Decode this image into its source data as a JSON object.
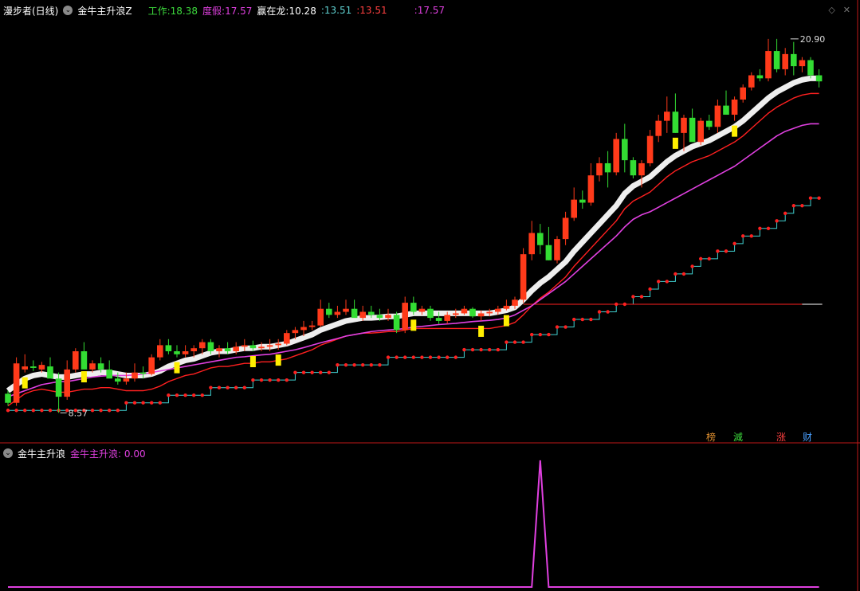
{
  "main_panel": {
    "stock_name": "漫步者(日线)",
    "indicator_name": "金牛主升浪Z",
    "legend": [
      {
        "label": "工作:",
        "value": "18.38",
        "color": "#3ddc3d"
      },
      {
        "label": "度假:",
        "value": "17.57",
        "color": "#e040e0"
      },
      {
        "label": "赢在龙:",
        "value": "10.28",
        "color": "#ffffff"
      },
      {
        "label": ":",
        "value": "13.51",
        "color": "#5fd0d0"
      },
      {
        "label": ":",
        "value": "13.51",
        "color": "#ff4040"
      },
      {
        "label": ":",
        "value": "17.57",
        "color": "#e040e0"
      }
    ],
    "high_marker": "20.90",
    "low_marker": "8.57",
    "icons": [
      "diamond-icon",
      "close-icon"
    ],
    "badges": [
      {
        "label": "榜",
        "color": "#e09030"
      },
      {
        "label": "減",
        "color": "#3ddc3d"
      },
      {
        "label": "涨",
        "color": "#ff4040"
      },
      {
        "label": "财",
        "color": "#4aa0ff"
      }
    ]
  },
  "sub_panel": {
    "indicator_name": "金牛主升浪",
    "legend_label": "金牛主升浪:",
    "legend_value": "0.00",
    "legend_color": "#e040e0"
  },
  "colors": {
    "up": "#ff3a1a",
    "down": "#33dd33",
    "support": "#ff3030",
    "mid": "#e040e0",
    "hint": "#ffee00",
    "stair": "#ff2020",
    "stair_line": "#40d0d0"
  },
  "chart_data": [
    {
      "type": "candlestick",
      "title": "漫步者(日线)",
      "y_range": [
        8.0,
        21.5
      ],
      "candles": [
        [
          9.2,
          9.3,
          8.8,
          8.9
        ],
        [
          8.9,
          10.4,
          8.8,
          10.2
        ],
        [
          10.0,
          10.5,
          9.9,
          10.1
        ],
        [
          10.1,
          10.3,
          9.95,
          10.05
        ],
        [
          10.0,
          10.25,
          9.9,
          10.15
        ],
        [
          10.1,
          10.4,
          9.9,
          9.7
        ],
        [
          9.7,
          9.9,
          8.57,
          9.1
        ],
        [
          9.1,
          10.3,
          9.0,
          10.0
        ],
        [
          10.0,
          10.7,
          9.9,
          10.6
        ],
        [
          10.6,
          10.9,
          10.1,
          10.0
        ],
        [
          10.0,
          10.3,
          9.9,
          10.2
        ],
        [
          10.2,
          10.4,
          9.9,
          10.0
        ],
        [
          10.0,
          10.3,
          9.8,
          9.7
        ],
        [
          9.7,
          9.9,
          9.5,
          9.6
        ],
        [
          9.6,
          9.9,
          9.5,
          9.7
        ],
        [
          9.7,
          10.2,
          9.6,
          9.9
        ],
        [
          9.9,
          10.1,
          9.7,
          9.85
        ],
        [
          9.85,
          10.5,
          9.8,
          10.4
        ],
        [
          10.4,
          11.0,
          10.3,
          10.8
        ],
        [
          10.8,
          11.0,
          10.5,
          10.6
        ],
        [
          10.6,
          10.8,
          10.4,
          10.5
        ],
        [
          10.5,
          10.8,
          10.4,
          10.6
        ],
        [
          10.6,
          10.8,
          10.4,
          10.7
        ],
        [
          10.7,
          11.0,
          10.5,
          10.9
        ],
        [
          10.9,
          11.0,
          10.5,
          10.6
        ],
        [
          10.6,
          10.8,
          10.4,
          10.7
        ],
        [
          10.7,
          10.9,
          10.5,
          10.6
        ],
        [
          10.6,
          10.9,
          10.5,
          10.75
        ],
        [
          10.75,
          11.0,
          10.6,
          10.8
        ],
        [
          10.8,
          10.95,
          10.6,
          10.7
        ],
        [
          10.7,
          10.9,
          10.6,
          10.75
        ],
        [
          10.75,
          11.0,
          10.6,
          10.8
        ],
        [
          10.8,
          11.0,
          10.65,
          10.85
        ],
        [
          10.85,
          11.3,
          10.8,
          11.2
        ],
        [
          11.2,
          11.4,
          11.0,
          11.3
        ],
        [
          11.3,
          11.6,
          11.1,
          11.4
        ],
        [
          11.4,
          11.6,
          11.3,
          11.45
        ],
        [
          11.45,
          12.3,
          11.4,
          12.0
        ],
        [
          12.0,
          12.2,
          11.7,
          11.8
        ],
        [
          11.8,
          12.1,
          11.7,
          11.9
        ],
        [
          11.9,
          12.3,
          11.8,
          12.0
        ],
        [
          12.0,
          12.3,
          11.9,
          11.7
        ],
        [
          11.7,
          12.1,
          11.6,
          11.9
        ],
        [
          11.9,
          12.1,
          11.7,
          11.8
        ],
        [
          11.8,
          12.0,
          11.6,
          11.7
        ],
        [
          11.7,
          12.0,
          11.6,
          11.8
        ],
        [
          11.8,
          11.9,
          11.2,
          11.3
        ],
        [
          11.3,
          12.4,
          11.2,
          12.2
        ],
        [
          12.2,
          12.4,
          11.8,
          11.9
        ],
        [
          11.9,
          12.1,
          11.8,
          12.0
        ],
        [
          12.0,
          12.1,
          11.6,
          11.7
        ],
        [
          11.7,
          11.9,
          11.5,
          11.6
        ],
        [
          11.6,
          11.9,
          11.5,
          11.8
        ],
        [
          11.8,
          12.0,
          11.7,
          11.85
        ],
        [
          11.85,
          12.1,
          11.8,
          12.0
        ],
        [
          12.0,
          12.05,
          11.7,
          11.75
        ],
        [
          11.75,
          11.95,
          11.6,
          11.85
        ],
        [
          11.85,
          12.0,
          11.75,
          11.9
        ],
        [
          11.9,
          12.1,
          11.8,
          12.0
        ],
        [
          12.0,
          12.3,
          11.95,
          12.1
        ],
        [
          12.1,
          12.4,
          12.0,
          12.3
        ],
        [
          12.3,
          14.0,
          12.2,
          13.8
        ],
        [
          13.8,
          14.9,
          13.6,
          14.5
        ],
        [
          14.5,
          14.8,
          13.8,
          14.1
        ],
        [
          14.1,
          14.7,
          13.6,
          13.6
        ],
        [
          13.6,
          14.4,
          13.5,
          14.3
        ],
        [
          14.3,
          15.2,
          14.1,
          15.0
        ],
        [
          15.0,
          16.0,
          14.9,
          15.6
        ],
        [
          15.6,
          15.9,
          15.3,
          15.5
        ],
        [
          15.5,
          16.8,
          15.4,
          16.4
        ],
        [
          16.4,
          17.0,
          16.2,
          16.8
        ],
        [
          16.8,
          17.2,
          16.0,
          16.5
        ],
        [
          16.5,
          17.8,
          16.4,
          17.6
        ],
        [
          17.6,
          18.1,
          16.5,
          16.9
        ],
        [
          16.9,
          17.0,
          16.3,
          16.4
        ],
        [
          16.4,
          16.9,
          16.0,
          16.8
        ],
        [
          16.8,
          17.9,
          16.7,
          17.7
        ],
        [
          17.7,
          18.4,
          17.5,
          18.2
        ],
        [
          18.2,
          19.0,
          17.8,
          18.5
        ],
        [
          18.5,
          19.1,
          17.8,
          17.8
        ],
        [
          17.8,
          18.4,
          17.2,
          18.3
        ],
        [
          18.3,
          18.6,
          17.5,
          17.5
        ],
        [
          17.5,
          18.3,
          17.4,
          18.2
        ],
        [
          18.2,
          18.4,
          17.9,
          18.0
        ],
        [
          18.0,
          18.9,
          17.8,
          18.7
        ],
        [
          18.7,
          19.2,
          18.4,
          18.4
        ],
        [
          18.4,
          19.0,
          18.2,
          18.9
        ],
        [
          18.9,
          19.4,
          18.8,
          19.3
        ],
        [
          19.3,
          19.8,
          19.2,
          19.7
        ],
        [
          19.7,
          19.9,
          19.5,
          19.6
        ],
        [
          19.6,
          20.9,
          19.5,
          20.5
        ],
        [
          20.5,
          20.9,
          19.8,
          19.9
        ],
        [
          19.9,
          20.6,
          19.7,
          20.4
        ],
        [
          20.4,
          20.8,
          19.7,
          20.0
        ],
        [
          20.0,
          20.3,
          19.8,
          20.2
        ],
        [
          20.2,
          20.3,
          19.6,
          19.7
        ],
        [
          19.7,
          19.9,
          19.3,
          19.5
        ]
      ],
      "series": [
        {
          "name": "工作",
          "values": [
            9.3,
            9.5,
            9.7,
            9.8,
            9.85,
            9.8,
            9.75,
            9.75,
            9.8,
            9.85,
            9.85,
            9.9,
            9.9,
            9.85,
            9.8,
            9.8,
            9.8,
            9.85,
            9.95,
            10.1,
            10.2,
            10.3,
            10.35,
            10.45,
            10.55,
            10.6,
            10.6,
            10.65,
            10.7,
            10.7,
            10.75,
            10.75,
            10.8,
            10.85,
            10.95,
            11.05,
            11.15,
            11.3,
            11.4,
            11.5,
            11.6,
            11.65,
            11.7,
            11.7,
            11.72,
            11.75,
            11.75,
            11.8,
            11.85,
            11.85,
            11.85,
            11.85,
            11.85,
            11.85,
            11.85,
            11.85,
            11.85,
            11.85,
            11.9,
            11.95,
            12.05,
            12.3,
            12.6,
            12.85,
            13.05,
            13.3,
            13.55,
            13.9,
            14.2,
            14.5,
            14.8,
            15.1,
            15.4,
            15.8,
            16.05,
            16.2,
            16.35,
            16.6,
            16.85,
            17.05,
            17.2,
            17.35,
            17.45,
            17.55,
            17.7,
            17.85,
            18.0,
            18.2,
            18.45,
            18.7,
            18.95,
            19.15,
            19.3,
            19.45,
            19.55,
            19.6,
            19.6
          ]
        },
        {
          "name": "度假",
          "values": [
            9.1,
            9.2,
            9.3,
            9.4,
            9.5,
            9.55,
            9.6,
            9.6,
            9.65,
            9.7,
            9.75,
            9.78,
            9.8,
            9.8,
            9.8,
            9.82,
            9.85,
            9.9,
            9.95,
            10.0,
            10.05,
            10.1,
            10.15,
            10.2,
            10.25,
            10.3,
            10.35,
            10.4,
            10.42,
            10.45,
            10.48,
            10.5,
            10.55,
            10.6,
            10.65,
            10.72,
            10.8,
            10.88,
            10.95,
            11.02,
            11.1,
            11.15,
            11.2,
            11.25,
            11.28,
            11.3,
            11.32,
            11.35,
            11.4,
            11.42,
            11.45,
            11.48,
            11.5,
            11.52,
            11.55,
            11.58,
            11.6,
            11.62,
            11.65,
            11.7,
            11.8,
            11.95,
            12.1,
            12.3,
            12.5,
            12.7,
            12.9,
            13.15,
            13.4,
            13.65,
            13.9,
            14.15,
            14.4,
            14.7,
            14.95,
            15.1,
            15.2,
            15.35,
            15.5,
            15.65,
            15.8,
            15.95,
            16.1,
            16.25,
            16.4,
            16.55,
            16.7,
            16.9,
            17.1,
            17.3,
            17.5,
            17.7,
            17.85,
            17.95,
            18.05,
            18.1,
            18.1
          ]
        },
        {
          "name": "赢在龙",
          "values": [
            8.9,
            8.9,
            8.95,
            8.95,
            9.0,
            9.0,
            9.0,
            9.0,
            9.0,
            9.05,
            9.05,
            9.1,
            9.1,
            9.1,
            9.15,
            9.2,
            9.25,
            9.3,
            9.35,
            9.4,
            9.45,
            9.5,
            9.55,
            9.6,
            9.65,
            9.7,
            9.75,
            9.8,
            9.85,
            9.9,
            9.95,
            10.0,
            10.05,
            10.1,
            10.15,
            10.2,
            10.25,
            10.3,
            10.35,
            10.4,
            10.45,
            10.5,
            10.55,
            10.6,
            10.62,
            10.65,
            10.68,
            10.7,
            10.72,
            10.75,
            10.78,
            10.8,
            10.82,
            10.85,
            10.9,
            10.95,
            11.0,
            11.05,
            11.1,
            11.15,
            11.2,
            11.3,
            11.4,
            11.5,
            11.6,
            11.7,
            11.8,
            11.9,
            12.0,
            12.1,
            12.2,
            12.3,
            12.4,
            12.55,
            12.7,
            12.85,
            13.0,
            13.15,
            13.3,
            13.45,
            13.6,
            13.75,
            13.9,
            14.05,
            14.2,
            14.35,
            14.5,
            14.65,
            14.8,
            14.95,
            15.1,
            15.3,
            15.5,
            15.7,
            15.85,
            15.95,
            16.0
          ]
        },
        {
          "name": "主升浪",
          "values": [
            0,
            0,
            0,
            0,
            0,
            0,
            0,
            0,
            0,
            0,
            0,
            0,
            0,
            0,
            0,
            0,
            0,
            0,
            0,
            0,
            0,
            0,
            0,
            0,
            0,
            0,
            0,
            0,
            0,
            0,
            0,
            0,
            0,
            0,
            0,
            0,
            0,
            0,
            0,
            0,
            0,
            0,
            0,
            0,
            0,
            0,
            0,
            0,
            0,
            0,
            0,
            0,
            0,
            0,
            0,
            0,
            0,
            0,
            0,
            0,
            0,
            0,
            0,
            0,
            0,
            0,
            0,
            0,
            0,
            0,
            0,
            0,
            0,
            0,
            0,
            0,
            0,
            0,
            0,
            0,
            0,
            0,
            0,
            0,
            0,
            0,
            0,
            0,
            0,
            0,
            0,
            0,
            0,
            0,
            0,
            0,
            0
          ]
        }
      ]
    },
    {
      "type": "line",
      "title": "金牛主升浪",
      "y_range": [
        0,
        1
      ],
      "series": [
        {
          "name": "金牛主升浪",
          "values": [
            0,
            0,
            0,
            0,
            0,
            0,
            0,
            0,
            0,
            0,
            0,
            0,
            0,
            0,
            0,
            0,
            0,
            0,
            0,
            0,
            0,
            0,
            0,
            0,
            0,
            0,
            0,
            0,
            0,
            0,
            0,
            0,
            0,
            0,
            0,
            0,
            0,
            0,
            0,
            0,
            0,
            0,
            0,
            0,
            0,
            0,
            0,
            0,
            0,
            0,
            0,
            0,
            0,
            0,
            0,
            0,
            0,
            0,
            0,
            0,
            0,
            0,
            0,
            1,
            0,
            0,
            0,
            0,
            0,
            0,
            0,
            0,
            0,
            0,
            0,
            0,
            0,
            0,
            0,
            0,
            0,
            0,
            0,
            0,
            0,
            0,
            0,
            0,
            0,
            0,
            0,
            0,
            0,
            0,
            0,
            0,
            0
          ]
        }
      ]
    }
  ]
}
